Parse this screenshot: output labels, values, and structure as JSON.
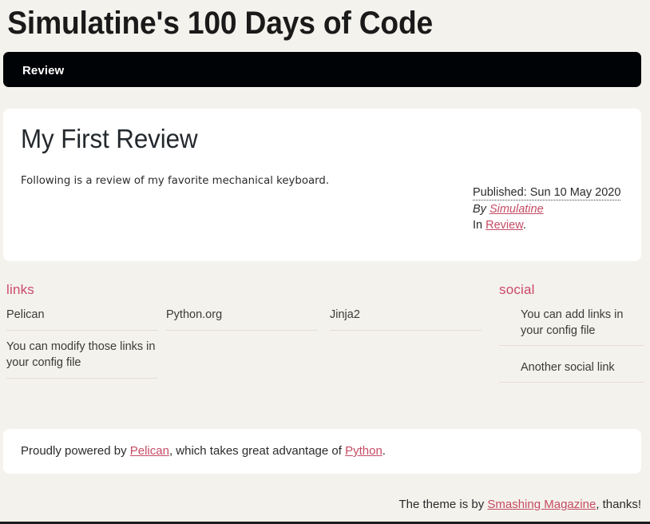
{
  "site": {
    "title": "Simulatine's 100 Days of Code",
    "background_color": "#f4f2ec",
    "accent_color": "#c54b63",
    "heading_accent_color": "#cb4a69",
    "nav_background_color": "#000306",
    "card_background_color": "#ffffff"
  },
  "nav": {
    "items": [
      {
        "label": "Review"
      }
    ]
  },
  "article": {
    "title": "My First Review",
    "summary": "Following is a review of my favorite mechanical keyboard.",
    "meta": {
      "published_label": "Published:",
      "published_date": "Sun 10 May 2020",
      "published_full": "Published: Sun 10 May 2020",
      "by_label": "By",
      "author": "Simulatine",
      "in_label": "In",
      "category": "Review",
      "period": "."
    }
  },
  "widgets": {
    "links": {
      "heading": "links",
      "items": [
        {
          "label": "Pelican"
        },
        {
          "label": "You can modify those links in your config file"
        },
        {
          "label": "Python.org"
        },
        {
          "label": "Jinja2"
        }
      ]
    },
    "social": {
      "heading": "social",
      "items": [
        {
          "label": "You can add links in your config file"
        },
        {
          "label": "Another social link"
        }
      ]
    }
  },
  "footer": {
    "powered_prefix": "Proudly powered by ",
    "powered_link_1": "Pelican",
    "powered_middle": ", which takes great advantage of ",
    "powered_link_2": "Python",
    "powered_suffix": ".",
    "theme_prefix": "The theme is by ",
    "theme_link": "Smashing Magazine",
    "theme_suffix": ", thanks!"
  }
}
